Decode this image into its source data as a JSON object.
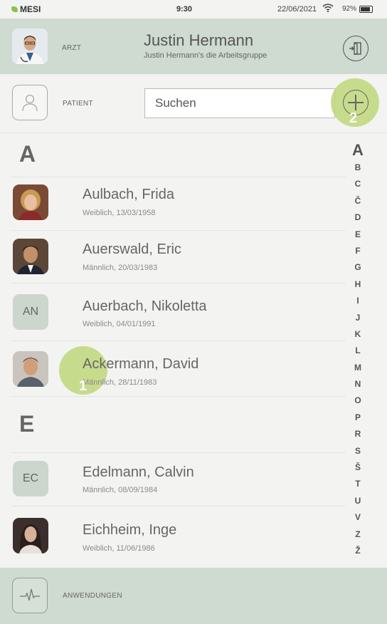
{
  "status_bar": {
    "brand": "MESI",
    "time": "9:30",
    "date": "22/06/2021",
    "battery": "92%"
  },
  "doctor": {
    "role_label": "ARZT",
    "name": "Justin Hermann",
    "group": "Justin Hermann's die Arbeitsgruppe"
  },
  "patient_bar": {
    "role_label": "PATIENT",
    "search_placeholder": "Suchen"
  },
  "hints": {
    "hint1": "1",
    "hint2": "2"
  },
  "sections": [
    {
      "letter": "A",
      "patients": [
        {
          "name": "Aulbach, Frida",
          "meta": "Weiblich, 13/03/1958",
          "initials": ""
        },
        {
          "name": "Auerswald, Eric",
          "meta": "Männlich, 20/03/1983",
          "initials": ""
        },
        {
          "name": "Auerbach, Nikoletta",
          "meta": "Weiblich, 04/01/1991",
          "initials": "AN"
        },
        {
          "name": "Ackermann, David",
          "meta": "Männlich, 28/11/1983",
          "initials": ""
        }
      ]
    },
    {
      "letter": "E",
      "patients": [
        {
          "name": "Edelmann, Calvin",
          "meta": "Männlich, 08/09/1984",
          "initials": "EC"
        },
        {
          "name": "Eichheim, Inge",
          "meta": "Weiblich, 11/06/1986",
          "initials": ""
        }
      ]
    }
  ],
  "alphabet_index": [
    "A",
    "B",
    "C",
    "Č",
    "D",
    "E",
    "F",
    "G",
    "H",
    "I",
    "J",
    "K",
    "L",
    "M",
    "N",
    "O",
    "P",
    "R",
    "S",
    "Š",
    "T",
    "U",
    "V",
    "Z",
    "Ž"
  ],
  "bottom_bar": {
    "label": "ANWENDUNGEN"
  },
  "colors": {
    "header_bg": "#cfdad0",
    "accent_hint": "#bed67a",
    "page_bg": "#f3f3f1",
    "initials_bg": "#ccd6cc"
  }
}
